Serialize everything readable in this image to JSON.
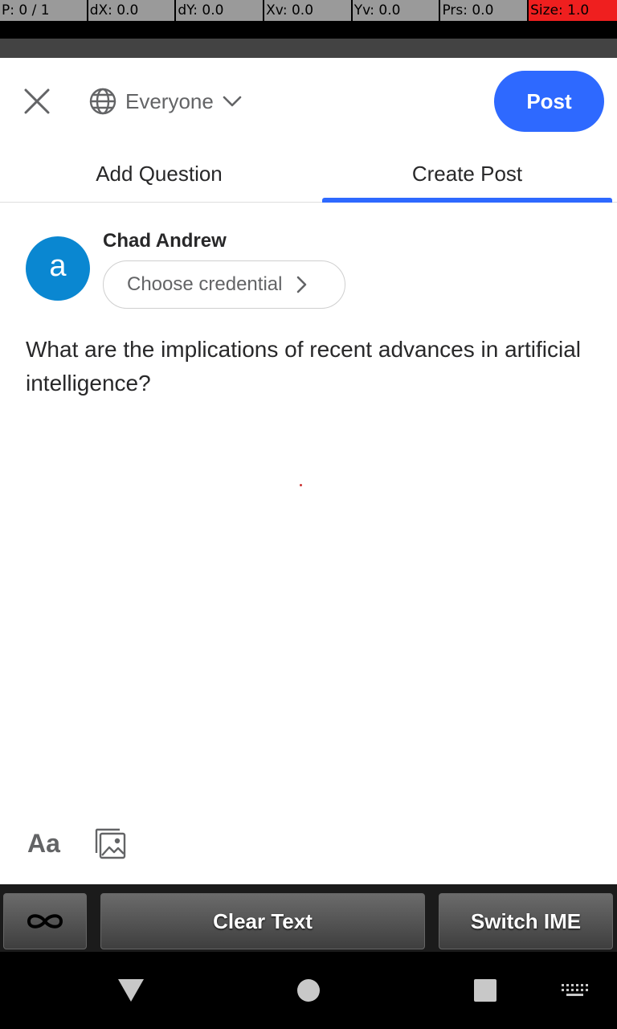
{
  "debug": {
    "p": "P: 0 / 1",
    "dx": "dX: 0.0",
    "dy": "dY: 0.0",
    "xv": "Xv: 0.0",
    "yv": "Yv: 0.0",
    "prs": "Prs: 0.0",
    "size": "Size: 1.0"
  },
  "header": {
    "close_icon": "close-icon",
    "audience_icon": "globe-icon",
    "audience_label": "Everyone",
    "post_label": "Post"
  },
  "tabs": [
    {
      "label": "Add Question",
      "active": false
    },
    {
      "label": "Create Post",
      "active": true
    }
  ],
  "author": {
    "avatar_letter": "a",
    "name": "Chad Andrew",
    "credential_label": "Choose credential"
  },
  "compose": {
    "text": "What are the implications of recent advances in artificial intelligence?"
  },
  "format": {
    "text_style_label": "Aa",
    "image_icon": "image-icon"
  },
  "ime": {
    "clear_label": "Clear Text",
    "switch_label": "Switch IME"
  },
  "colors": {
    "accent": "#2e69ff",
    "avatar": "#0a87d1",
    "warn": "#ef1f1f"
  }
}
